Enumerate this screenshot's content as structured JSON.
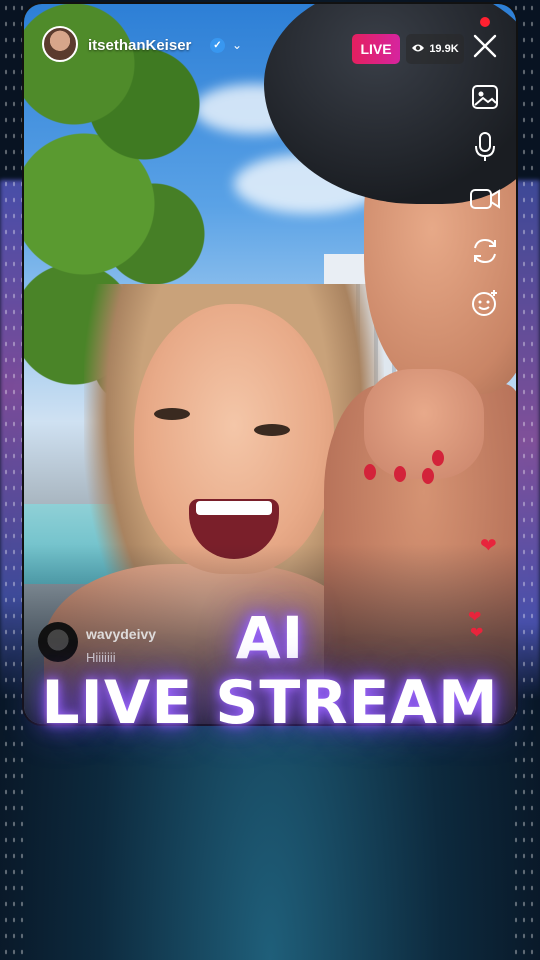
{
  "stream": {
    "username": "itsethanKeiser",
    "verified_icon": "verified-badge-icon",
    "live_label": "LIVE",
    "viewer_count": "19.9K"
  },
  "toolbar": {
    "close_icon": "close-icon",
    "tools": [
      "image-icon",
      "microphone-icon",
      "video-camera-icon",
      "switch-camera-icon",
      "face-effects-icon"
    ]
  },
  "comment": {
    "user": "wavydeivy",
    "text": "Hiiiiiii"
  },
  "overlay_title": {
    "line1": "AI",
    "line2": "LIVE STREAM"
  },
  "colors": {
    "live_badge": "#e4205f",
    "heart": "#e8243c",
    "title_glow": "#a46bff",
    "verified": "#3897f0"
  }
}
